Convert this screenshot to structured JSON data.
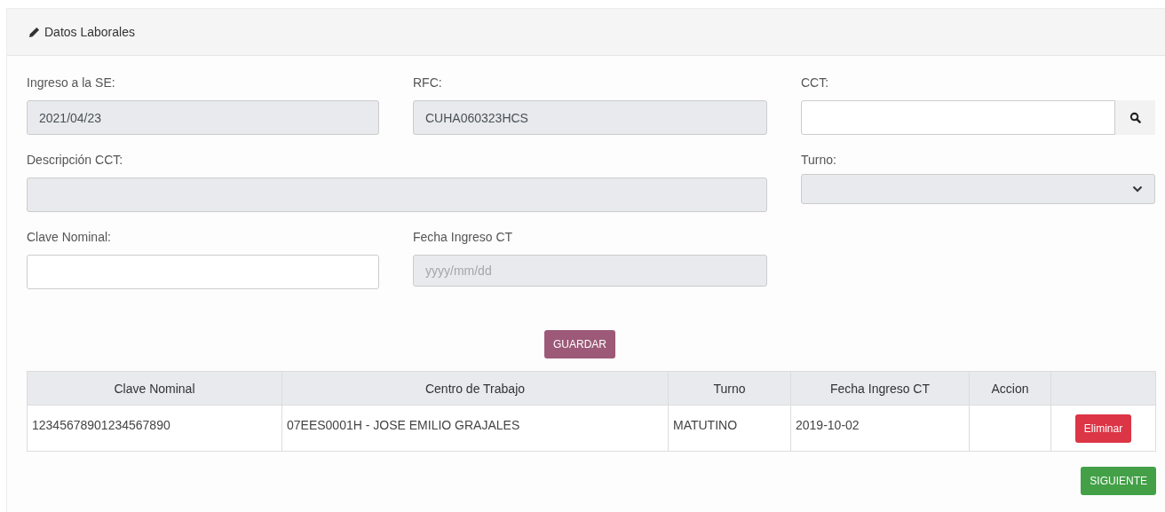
{
  "panel": {
    "title": "Datos Laborales"
  },
  "fields": [
    {
      "label": "Ingreso a la SE:",
      "kind": "text",
      "value": "2021/04/23",
      "disabled": true
    },
    {
      "label": "RFC:",
      "kind": "text",
      "value": "CUHA060323HCS",
      "disabled": true
    },
    {
      "label": "CCT:",
      "kind": "search",
      "disabled": false
    },
    {
      "label": "Descripción CCT:",
      "kind": "text",
      "disabled": true
    },
    {
      "label": "Turno:",
      "kind": "select",
      "disabled": true
    },
    {
      "label": "Clave Nominal:",
      "kind": "text",
      "disabled": false
    },
    {
      "label": "Fecha Ingreso CT",
      "kind": "text",
      "placeholder": "yyyy/mm/dd",
      "disabled": true
    }
  ],
  "save_button": "GUARDAR",
  "table": {
    "columns": [
      "Clave Nominal",
      "Centro de Trabajo",
      "Turno",
      "Fecha Ingreso CT",
      "Accion"
    ],
    "rows": [
      {
        "cells": [
          "12345678901234567890",
          "07EES0001H - JOSE EMILIO GRAJALES",
          "MATUTINO",
          "2019-10-02",
          ""
        ],
        "action": "Eliminar"
      }
    ]
  },
  "next_button": "SIGUIENTE"
}
